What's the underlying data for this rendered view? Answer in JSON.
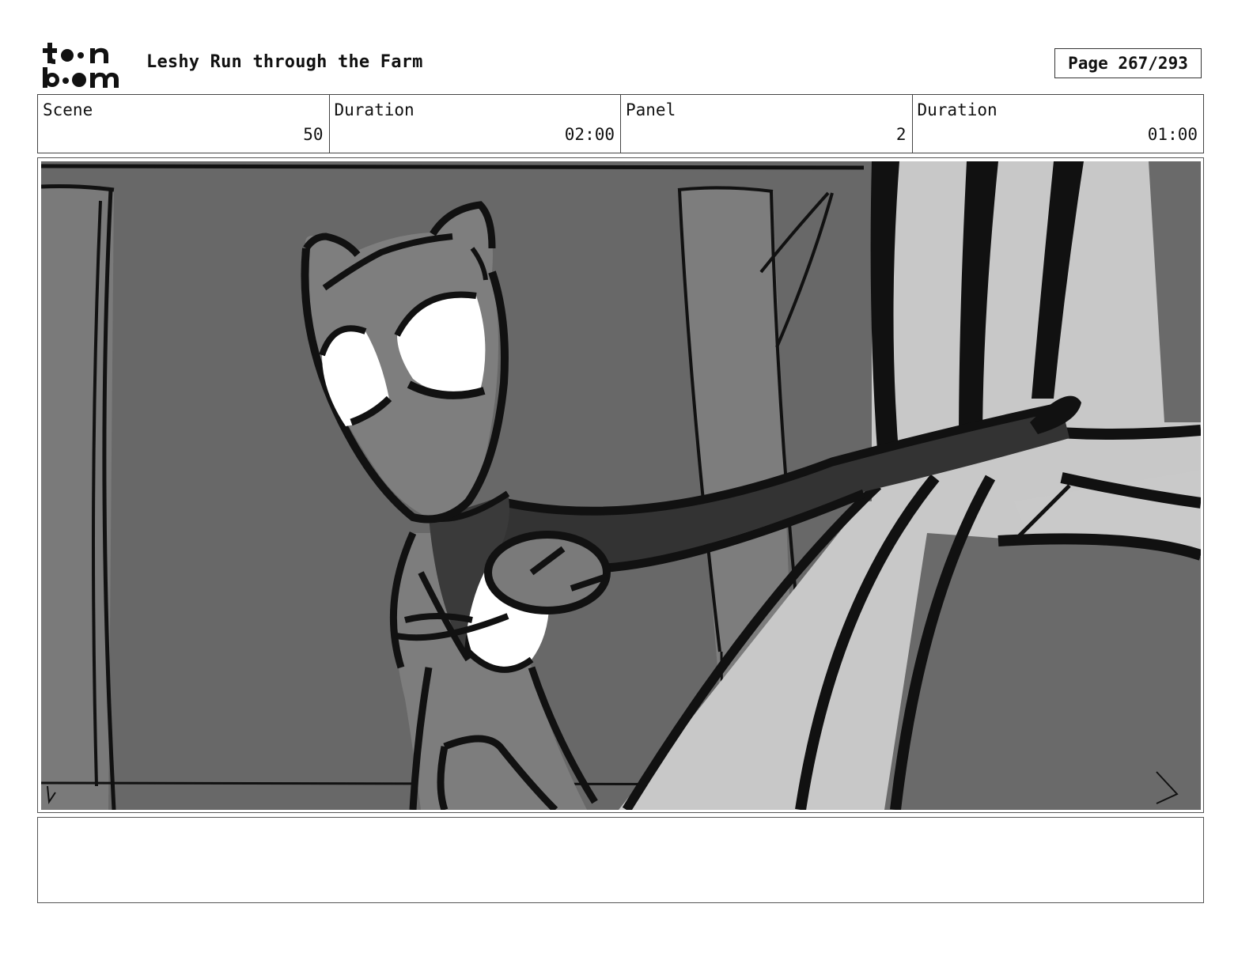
{
  "header": {
    "logo_text": "toon boom",
    "title": "Leshy Run through the Farm",
    "page_label": "Page 267/293"
  },
  "info": {
    "scene_label": "Scene",
    "scene_value": "50",
    "scene_duration_label": "Duration",
    "scene_duration_value": "02:00",
    "panel_label": "Panel",
    "panel_value": "2",
    "panel_duration_label": "Duration",
    "panel_duration_value": "01:00"
  },
  "notes": {
    "text": ""
  }
}
